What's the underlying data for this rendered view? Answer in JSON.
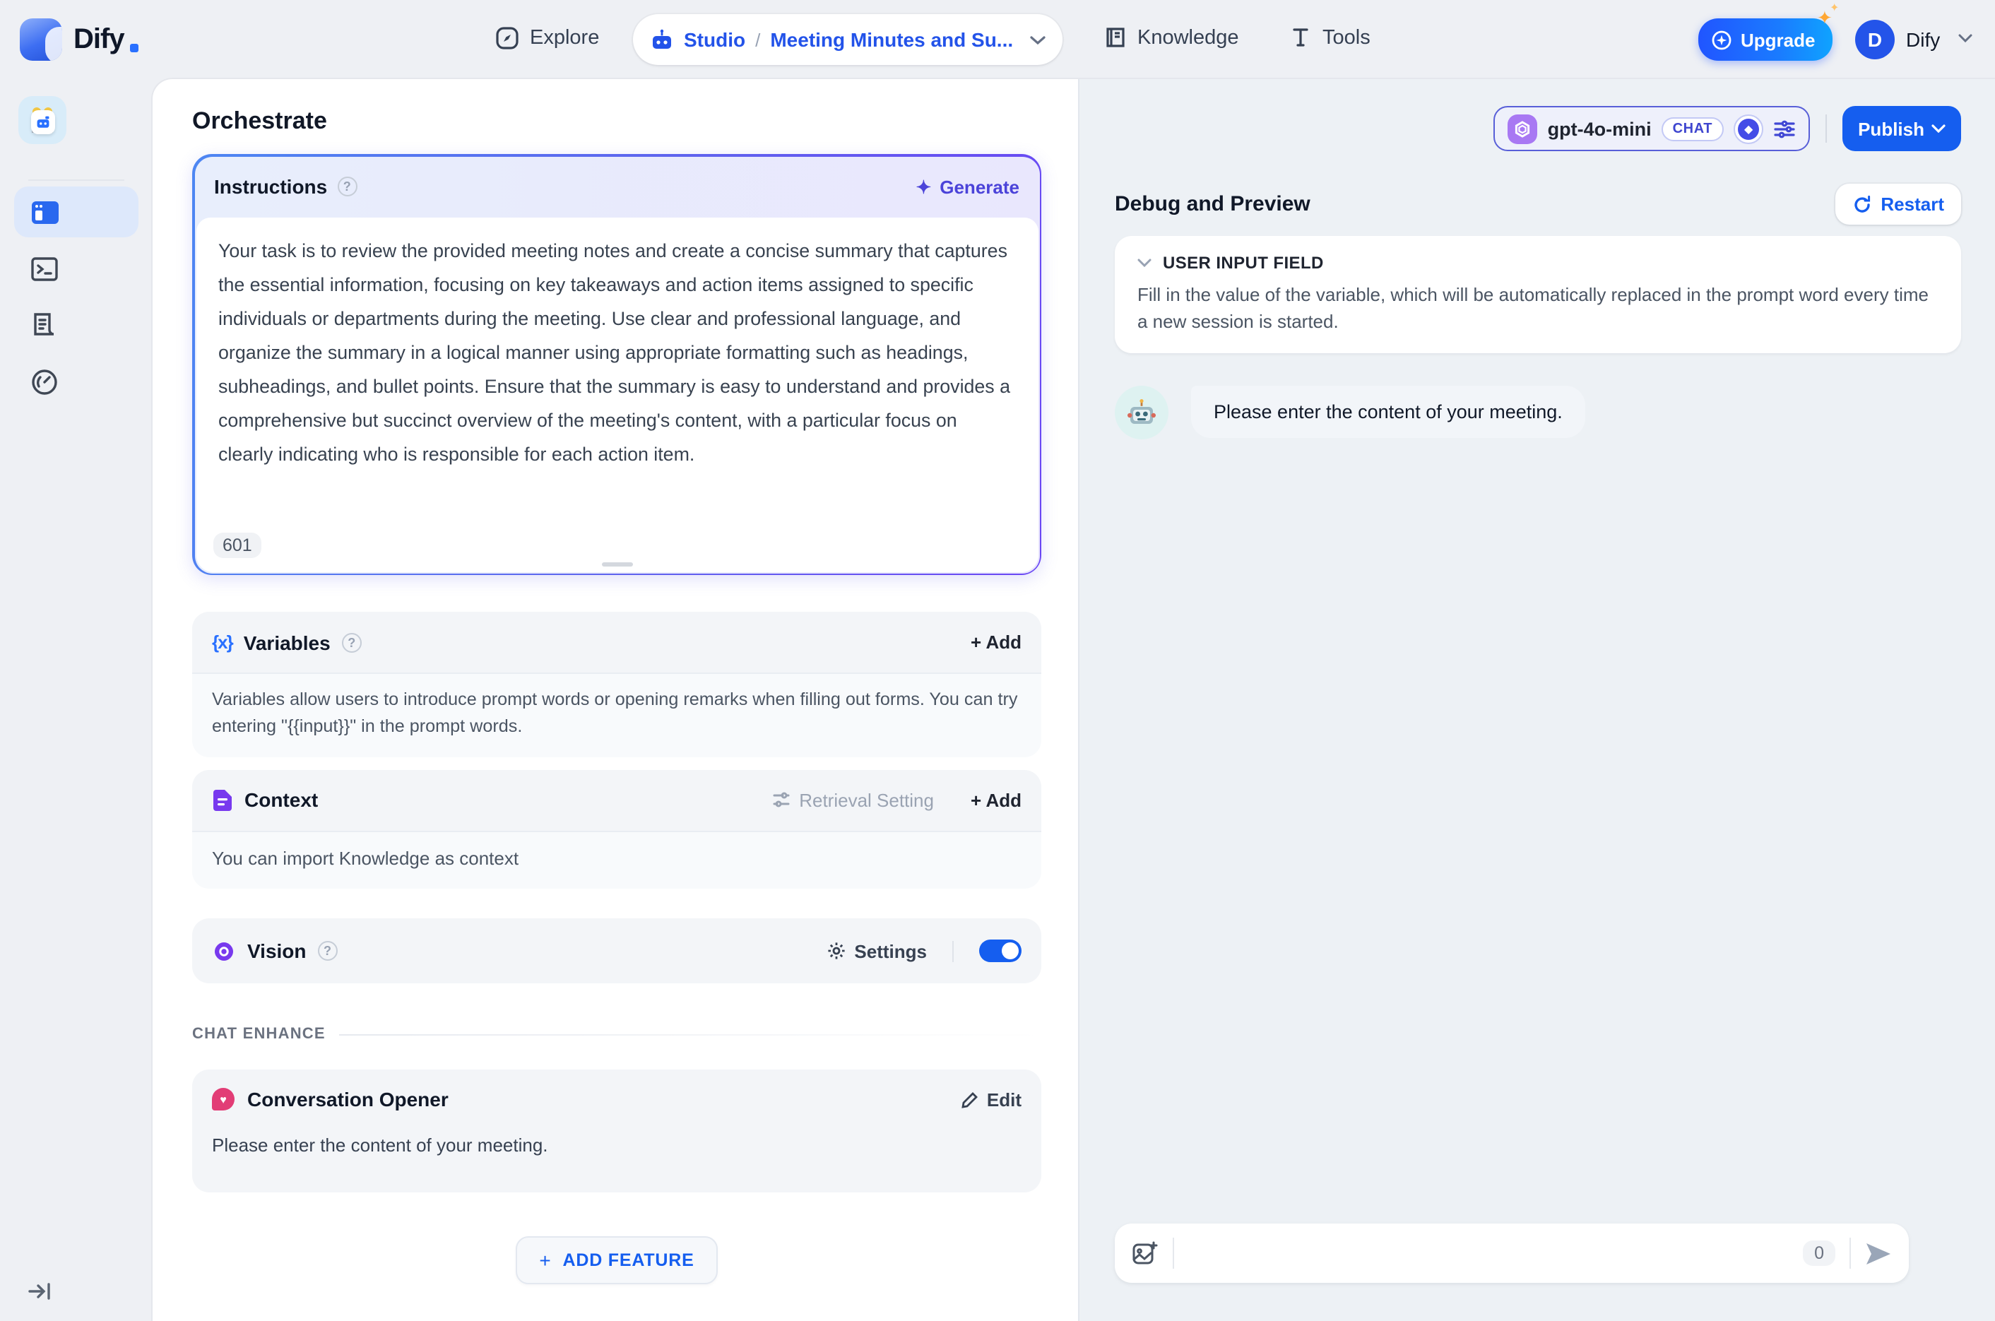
{
  "colors": {
    "accent_blue": "#155eef",
    "indigo": "#444ce7",
    "purple": "#7839ee",
    "pink": "#e23d76",
    "crumb_blue": "#2353e9"
  },
  "header": {
    "logo_text": "Dify",
    "nav": {
      "explore": "Explore",
      "knowledge": "Knowledge",
      "tools": "Tools"
    },
    "breadcrumb": {
      "studio": "Studio",
      "separator": "/",
      "app_name": "Meeting Minutes and Su..."
    },
    "upgrade_label": "Upgrade",
    "account": {
      "avatar_initial": "D",
      "name": "Dify"
    }
  },
  "page": {
    "title": "Orchestrate"
  },
  "model_bar": {
    "model_name": "gpt-4o-mini",
    "mode_badge": "CHAT",
    "publish_label": "Publish"
  },
  "instructions": {
    "title": "Instructions",
    "help_glyph": "?",
    "sparkle_glyph": "✦",
    "generate_label": "Generate",
    "body": "Your task is to review the provided meeting notes and create a concise summary that captures the essential information, focusing on key takeaways and action items assigned to specific individuals or departments during the meeting. Use clear and professional language, and organize the summary in a logical manner using appropriate formatting such as headings, subheadings, and bullet points. Ensure that the summary is easy to understand and provides a comprehensive but succinct overview of the meeting's content, with a particular focus on clearly indicating who is responsible for each action item.",
    "char_count": "601"
  },
  "variables": {
    "icon_glyph": "{x}",
    "title": "Variables",
    "help_glyph": "?",
    "add_label": "+ Add",
    "body": "Variables allow users to introduce prompt words or opening remarks when filling out forms. You can try entering \"{{input}}\" in the prompt words."
  },
  "context": {
    "title": "Context",
    "retrieval_label": "Retrieval Setting",
    "add_label": "+ Add",
    "body": "You can import Knowledge as context"
  },
  "vision": {
    "title": "Vision",
    "help_glyph": "?",
    "settings_label": "Settings"
  },
  "chat_enhance": {
    "label": "CHAT ENHANCE"
  },
  "conversation_opener": {
    "title": "Conversation Opener",
    "edit_label": "Edit",
    "heart_glyph": "♥",
    "body": "Please enter the content of your meeting."
  },
  "add_feature": {
    "plus_glyph": "+",
    "label": "ADD FEATURE"
  },
  "debug": {
    "title": "Debug and Preview",
    "restart_label": "Restart",
    "user_input_field": {
      "title": "USER INPUT FIELD",
      "body": "Fill in the value of the variable, which will be automatically replaced in the prompt word every time a new session is started."
    },
    "bot_message": "Please enter the content of your meeting.",
    "input": {
      "char_count": "0"
    }
  },
  "glyphs": {
    "diamond": "◆",
    "spark_small": "✦",
    "spark_tiny": "✦"
  }
}
